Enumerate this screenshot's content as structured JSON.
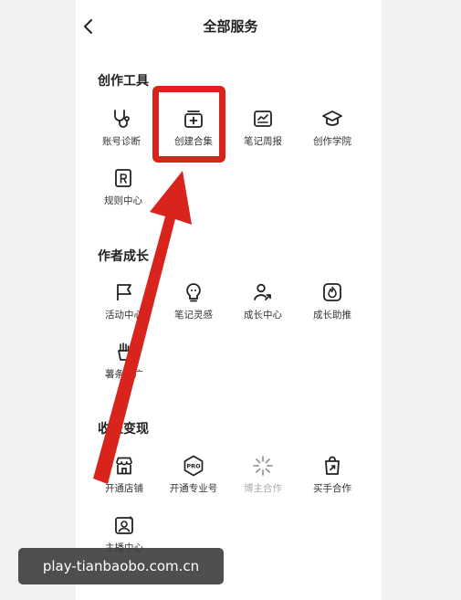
{
  "header": {
    "title": "全部服务"
  },
  "sections": [
    {
      "title": "创作工具",
      "items": [
        {
          "label": "账号诊断",
          "icon": "stethoscope-icon"
        },
        {
          "label": "创建合集",
          "icon": "add-collection-icon"
        },
        {
          "label": "笔记周报",
          "icon": "weekly-report-icon"
        },
        {
          "label": "创作学院",
          "icon": "graduation-cap-icon"
        },
        {
          "label": "规则中心",
          "icon": "rules-icon"
        }
      ]
    },
    {
      "title": "作者成长",
      "items": [
        {
          "label": "活动中心",
          "icon": "flag-icon"
        },
        {
          "label": "笔记灵感",
          "icon": "inspiration-icon"
        },
        {
          "label": "成长中心",
          "icon": "growth-icon"
        },
        {
          "label": "成长助推",
          "icon": "boost-icon"
        },
        {
          "label": "薯条推广",
          "icon": "fries-icon"
        }
      ]
    },
    {
      "title": "收益变现",
      "items": [
        {
          "label": "开通店铺",
          "icon": "store-icon"
        },
        {
          "label": "开通专业号",
          "icon": "pro-badge-icon"
        },
        {
          "label": "博主合作",
          "icon": "sparkle-icon"
        },
        {
          "label": "买手合作",
          "icon": "shopping-bag-icon"
        },
        {
          "label": "主播中心",
          "icon": "streamer-icon"
        }
      ]
    }
  ],
  "watermark": "play-tianbaobo.com.cn",
  "colors": {
    "highlight": "#d8241c",
    "text": "#222222",
    "muted": "#aaaaaa"
  }
}
